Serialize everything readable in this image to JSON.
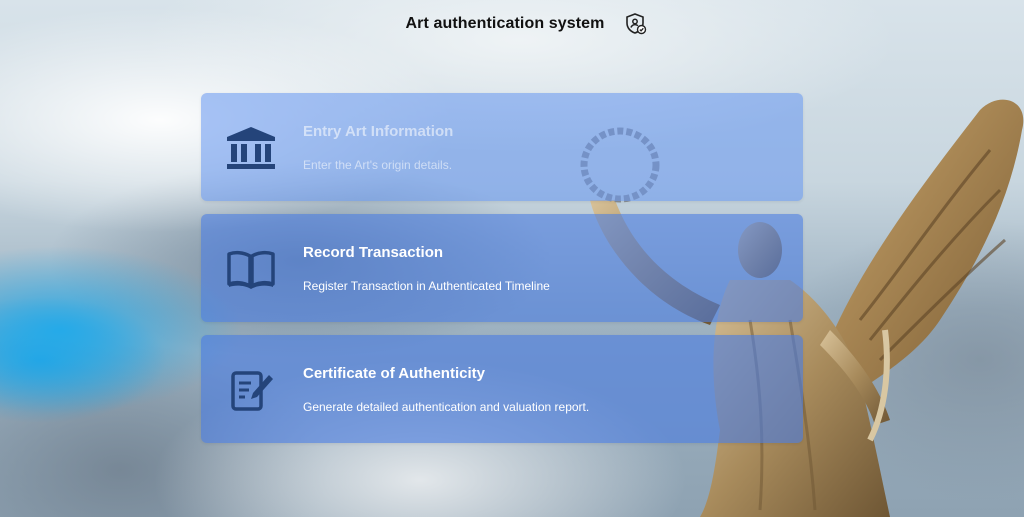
{
  "header": {
    "title": "Art authentication system",
    "icon": "shield-user-check-icon"
  },
  "cards": [
    {
      "title": "Entry Art Information",
      "description": "Enter the Art's origin details.",
      "icon": "museum-icon"
    },
    {
      "title": "Record Transaction",
      "description": "Register Transaction in Authenticated Timeline",
      "icon": "open-book-icon"
    },
    {
      "title": "Certificate of Authenticity",
      "description": "Generate detailed authentication and valuation report.",
      "icon": "document-pen-icon"
    }
  ],
  "colors": {
    "card": "#5a8ceb",
    "icon": "#24447a"
  }
}
